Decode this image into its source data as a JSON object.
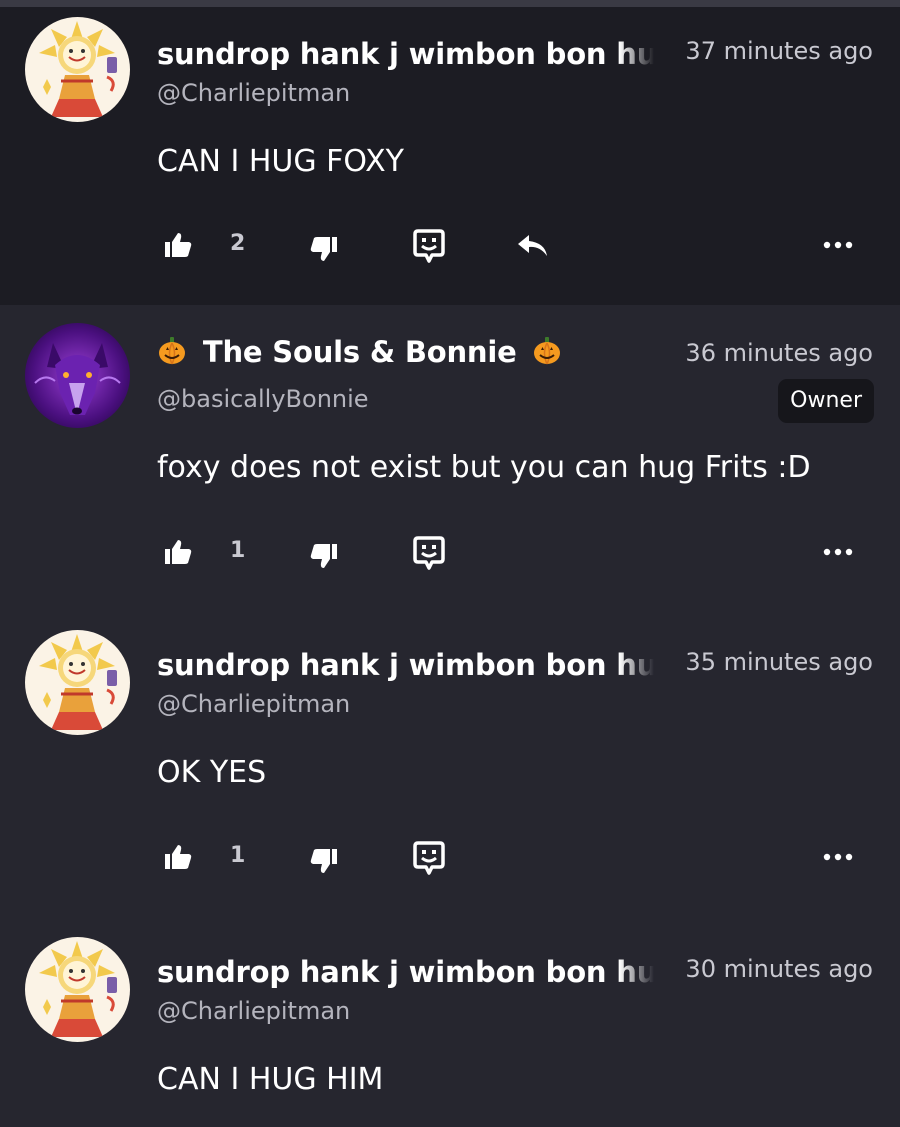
{
  "icons": {
    "like": "thumbs-up-icon",
    "dislike": "thumbs-down-icon",
    "award": "award-icon",
    "reply": "reply-icon",
    "more": "more-options-icon",
    "pumpkin": "pumpkin-emoji"
  },
  "comments": [
    {
      "display_name": "sundrop hank j wimbon bon hug",
      "handle": "@Charliepitman",
      "time": "37 minutes ago",
      "text": "CAN I HUG FOXY",
      "likes": "2"
    },
    {
      "display_name": "The Souls & Bonnie",
      "handle": "@basicallyBonnie",
      "time": "36 minutes ago",
      "badge": "Owner",
      "text": "foxy does not exist but you can hug Frits :D",
      "likes": "1"
    },
    {
      "display_name": "sundrop hank j wimbon bon hug",
      "handle": "@Charliepitman",
      "time": "35 minutes ago",
      "text": "OK YES",
      "likes": "1"
    },
    {
      "display_name": "sundrop hank j wimbon bon hug",
      "handle": "@Charliepitman",
      "time": "30 minutes ago",
      "text": "CAN I HUG HIM"
    }
  ]
}
